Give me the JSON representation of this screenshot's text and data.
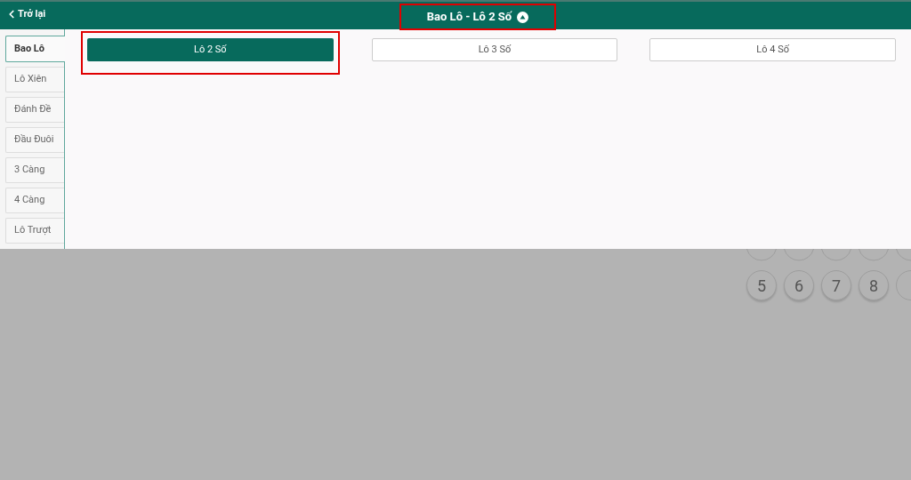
{
  "header": {
    "back": "Trở lại",
    "title": "Bao Lô - Lô 2 Số"
  },
  "sidebar": {
    "items": [
      {
        "label": "Bao Lô",
        "selected": true
      },
      {
        "label": "Lô Xiên",
        "selected": false
      },
      {
        "label": "Đánh Đề",
        "selected": false
      },
      {
        "label": "Đầu Đuôi",
        "selected": false
      },
      {
        "label": "3 Càng",
        "selected": false
      },
      {
        "label": "4 Càng",
        "selected": false
      },
      {
        "label": "Lô Trượt",
        "selected": false
      }
    ]
  },
  "options": [
    {
      "label": "Lô 2 Số",
      "selected": true
    },
    {
      "label": "Lô 3 Số",
      "selected": false
    },
    {
      "label": "Lô 4 Số",
      "selected": false
    }
  ],
  "keypad": {
    "keys": [
      "5",
      "6",
      "7",
      "8"
    ]
  }
}
